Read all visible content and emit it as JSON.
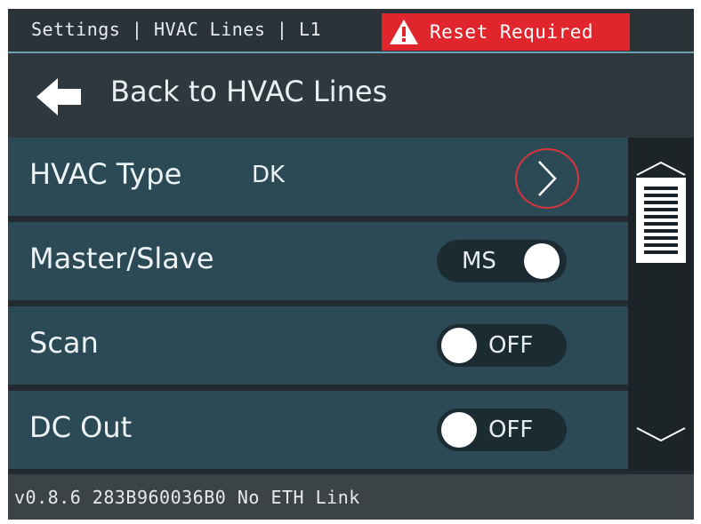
{
  "header": {
    "breadcrumb": "Settings | HVAC Lines | L1",
    "warning": {
      "label": "Reset Required",
      "icon": "warning-triangle-icon",
      "color": "#e0262c"
    }
  },
  "back": {
    "label": "Back to HVAC Lines",
    "icon": "arrow-left-icon"
  },
  "rows": [
    {
      "label": "HVAC Type",
      "value": "DK",
      "control": "chevron-right-icon"
    },
    {
      "label": "Master/Slave",
      "toggle": {
        "text": "MS",
        "state": "on"
      }
    },
    {
      "label": "Scan",
      "toggle": {
        "text": "OFF",
        "state": "off"
      }
    },
    {
      "label": "DC Out",
      "toggle": {
        "text": "OFF",
        "state": "off"
      }
    }
  ],
  "scrollbar": {
    "up_icon": "chevron-up-icon",
    "down_icon": "chevron-down-icon"
  },
  "footer": {
    "status": "v0.8.6  283B960036B0  No ETH Link"
  },
  "colors": {
    "row_bg": "#2b4a55",
    "background": "#232a30",
    "accent_line": "#6f9fb3",
    "highlight_ring": "#d9343a"
  }
}
